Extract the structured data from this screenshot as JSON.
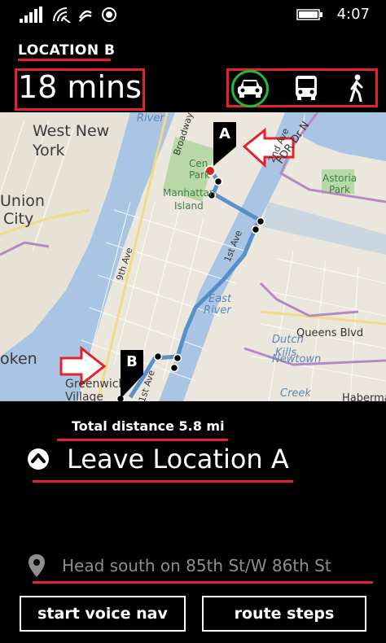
{
  "status_bar": {
    "time": "4:07",
    "icons": [
      "signal-icon",
      "wifi-icon",
      "data-sense-icon",
      "location-icon",
      "battery-icon"
    ]
  },
  "header": {
    "location_title": "LOCATION B",
    "eta": "18 mins",
    "modes": [
      {
        "name": "car-icon",
        "selected": true
      },
      {
        "name": "bus-icon",
        "selected": false
      },
      {
        "name": "walk-icon",
        "selected": false
      }
    ]
  },
  "map": {
    "labels": {
      "west_new_york_1": "West New",
      "west_new_york_2": "York",
      "union_city_1": "Union",
      "union_city_2": "City",
      "hoboken": "oken",
      "greenwich_1": "Greenwich",
      "greenwich_2": "Village",
      "river_top": "River",
      "central_park_1": "Cen",
      "central_park_2": "Park",
      "manhattan_1": "Manhattan",
      "manhattan_2": "Island",
      "east_river_1": "East",
      "east_river_2": "River",
      "queens_blvd": "Queens Blvd",
      "astoria_1": "Astoria",
      "astoria_2": "Park",
      "dutch_kills_1": "Dutch",
      "dutch_kills_2": "Kills",
      "newtown_1": "Newtown",
      "newtown_2": "Creek",
      "hoboken_right": "Haberman",
      "broadway": "Broadway",
      "second_ave": "2nd Ave",
      "first_ave": "1st Ave",
      "ninth_ave": "9th Ave",
      "first_ave_bottom": "1st Ave",
      "fdr": "FDR Dr N"
    },
    "pin_a": "A",
    "pin_b": "B"
  },
  "directions": {
    "total_distance": "Total distance 5.8 mi",
    "current_step": "Leave Location A",
    "next_step": "Head south on 85th St/W 86th St"
  },
  "buttons": {
    "voice_nav": "start voice nav",
    "route_steps": "route steps"
  },
  "colors": {
    "accent_red": "#e3222b",
    "selected_ring": "#1fbb3c",
    "route_blue": "#4a88c7"
  }
}
